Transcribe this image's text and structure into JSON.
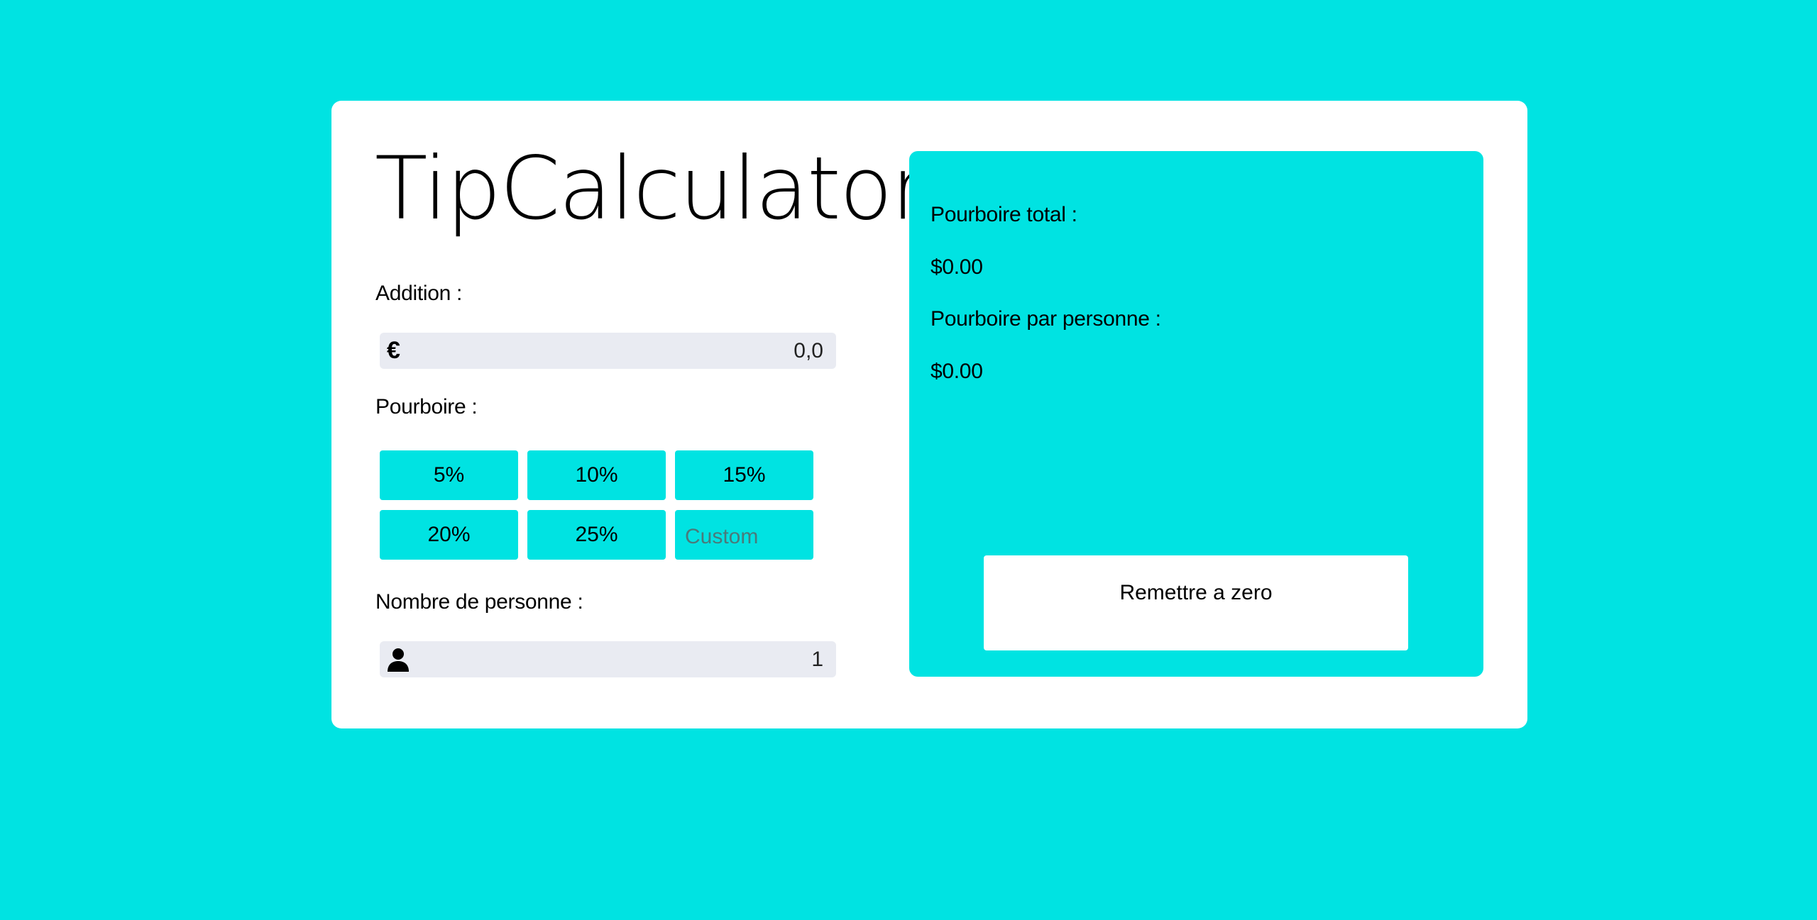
{
  "app": {
    "title": "TipCalculator"
  },
  "bill": {
    "label": "Addition :",
    "currency_icon": "euro-icon",
    "currency_symbol": "€",
    "value": "0,0"
  },
  "tip": {
    "label": "Pourboire :",
    "options": [
      "5%",
      "10%",
      "15%",
      "20%",
      "25%"
    ],
    "custom_placeholder": "Custom"
  },
  "people": {
    "label": "Nombre de personne :",
    "icon": "person-icon",
    "value": "1"
  },
  "results": {
    "total_label": "Pourboire total :",
    "total_value": "$0.00",
    "per_person_label": "Pourboire par personne :",
    "per_person_value": "$0.00",
    "reset_label": "Remettre a zero"
  },
  "colors": {
    "background": "#00e3e2",
    "card": "#ffffff",
    "input_bg": "#e9ebf2"
  }
}
